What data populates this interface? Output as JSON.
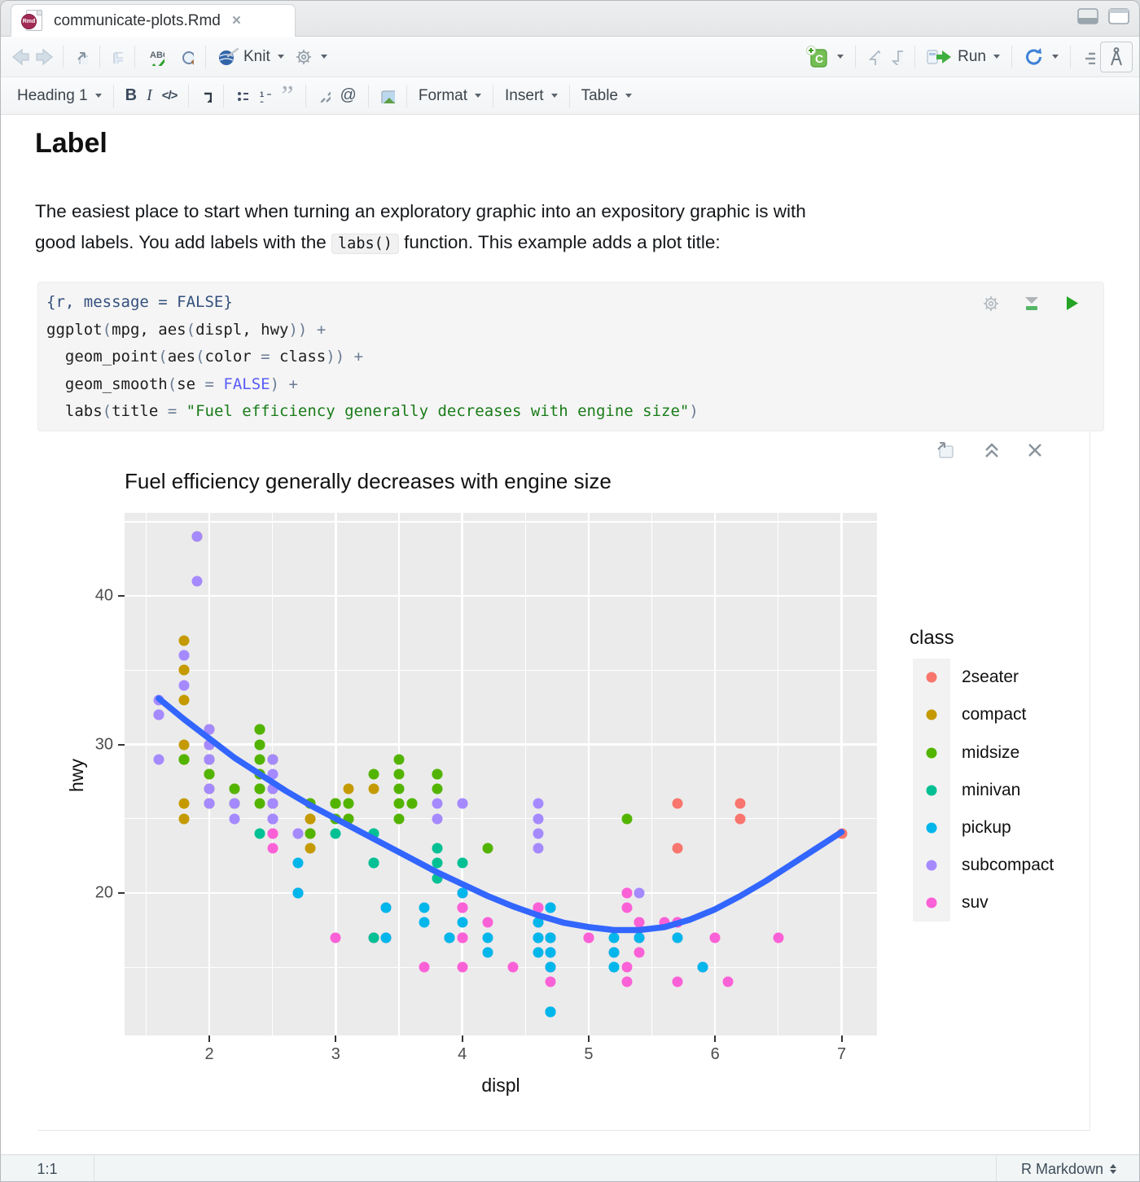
{
  "tab": {
    "title": "communicate-plots.Rmd"
  },
  "icons": {
    "close": "×",
    "quote": "”"
  },
  "toolbar": {
    "knit": "Knit",
    "run": "Run"
  },
  "format_bar": {
    "heading": "Heading 1",
    "bold": "B",
    "italic": "I",
    "code": "</>",
    "at": "@",
    "format": "Format",
    "insert": "Insert",
    "table": "Table"
  },
  "document": {
    "heading": "Label",
    "para_line1": "The easiest place to start when turning an exploratory graphic into an expository graphic is with",
    "para_line2_pre": "good labels. You add labels with the ",
    "para_code": "labs()",
    "para_line2_post": " function. This example adds a plot title:"
  },
  "code_chunk": {
    "colors": {
      "hdr": "#33507D",
      "txt": "#1E1E1E",
      "op": "#6B7B95",
      "const": "#585CF6",
      "str": "#1A7C1A"
    },
    "lines": [
      [
        {
          "t": "{r, message = FALSE}",
          "c": "hdr"
        }
      ],
      [
        {
          "t": "ggplot",
          "c": "txt"
        },
        {
          "t": "(",
          "c": "op"
        },
        {
          "t": "mpg, ",
          "c": "txt"
        },
        {
          "t": "aes",
          "c": "txt"
        },
        {
          "t": "(",
          "c": "op"
        },
        {
          "t": "displ, hwy",
          "c": "txt"
        },
        {
          "t": "))",
          "c": "op"
        },
        {
          "t": " ",
          "c": "txt"
        },
        {
          "t": "+",
          "c": "op"
        }
      ],
      [
        {
          "t": "  geom_point",
          "c": "txt"
        },
        {
          "t": "(",
          "c": "op"
        },
        {
          "t": "aes",
          "c": "txt"
        },
        {
          "t": "(",
          "c": "op"
        },
        {
          "t": "color ",
          "c": "txt"
        },
        {
          "t": "=",
          "c": "op"
        },
        {
          "t": " class",
          "c": "txt"
        },
        {
          "t": "))",
          "c": "op"
        },
        {
          "t": " ",
          "c": "txt"
        },
        {
          "t": "+",
          "c": "op"
        }
      ],
      [
        {
          "t": "  geom_smooth",
          "c": "txt"
        },
        {
          "t": "(",
          "c": "op"
        },
        {
          "t": "se ",
          "c": "txt"
        },
        {
          "t": "=",
          "c": "op"
        },
        {
          "t": " ",
          "c": "txt"
        },
        {
          "t": "FALSE",
          "c": "const"
        },
        {
          "t": ")",
          "c": "op"
        },
        {
          "t": " ",
          "c": "txt"
        },
        {
          "t": "+",
          "c": "op"
        }
      ],
      [
        {
          "t": "  labs",
          "c": "txt"
        },
        {
          "t": "(",
          "c": "op"
        },
        {
          "t": "title ",
          "c": "txt"
        },
        {
          "t": "=",
          "c": "op"
        },
        {
          "t": " ",
          "c": "txt"
        },
        {
          "t": "\"Fuel efficiency generally decreases with engine size\"",
          "c": "str"
        },
        {
          "t": ")",
          "c": "op"
        }
      ]
    ]
  },
  "chart_data": {
    "type": "scatter",
    "title": "Fuel efficiency generally decreases with engine size",
    "xlabel": "displ",
    "ylabel": "hwy",
    "xlim": [
      1.33,
      7.28
    ],
    "ylim": [
      10.4,
      45.6
    ],
    "x_ticks": [
      2,
      3,
      4,
      5,
      6,
      7
    ],
    "y_ticks": [
      20,
      30,
      40
    ],
    "x_minor": [
      1.5,
      2.5,
      3.5,
      4.5,
      5.5,
      6.5
    ],
    "y_minor": [
      15,
      25,
      35,
      45
    ],
    "panel_bg": "#ebebeb",
    "grid_color": "#ffffff",
    "legend": {
      "title": "class",
      "entries": [
        {
          "label": "2seater",
          "color": "#F8766D"
        },
        {
          "label": "compact",
          "color": "#C49A00"
        },
        {
          "label": "midsize",
          "color": "#53B400"
        },
        {
          "label": "minivan",
          "color": "#00C094"
        },
        {
          "label": "pickup",
          "color": "#00B6EB"
        },
        {
          "label": "subcompact",
          "color": "#A58AFF"
        },
        {
          "label": "suv",
          "color": "#FB61D7"
        }
      ]
    },
    "points": [
      [
        1.8,
        29,
        "compact"
      ],
      [
        1.8,
        29,
        "compact"
      ],
      [
        2,
        31,
        "compact"
      ],
      [
        2,
        30,
        "compact"
      ],
      [
        2.8,
        26,
        "compact"
      ],
      [
        2.8,
        26,
        "compact"
      ],
      [
        3.1,
        27,
        "compact"
      ],
      [
        1.8,
        26,
        "compact"
      ],
      [
        1.8,
        25,
        "compact"
      ],
      [
        2,
        28,
        "compact"
      ],
      [
        2,
        27,
        "compact"
      ],
      [
        2.8,
        25,
        "compact"
      ],
      [
        2.8,
        25,
        "compact"
      ],
      [
        3.1,
        25,
        "compact"
      ],
      [
        3.1,
        25,
        "compact"
      ],
      [
        2.2,
        26,
        "compact"
      ],
      [
        2.2,
        27,
        "compact"
      ],
      [
        2.4,
        28,
        "compact"
      ],
      [
        2.4,
        31,
        "compact"
      ],
      [
        3,
        26,
        "compact"
      ],
      [
        3,
        26,
        "compact"
      ],
      [
        3.3,
        27,
        "compact"
      ],
      [
        1.8,
        30,
        "compact"
      ],
      [
        1.8,
        33,
        "compact"
      ],
      [
        1.8,
        35,
        "compact"
      ],
      [
        1.8,
        37,
        "compact"
      ],
      [
        1.8,
        35,
        "compact"
      ],
      [
        2,
        29,
        "compact"
      ],
      [
        2,
        26,
        "compact"
      ],
      [
        2,
        29,
        "compact"
      ],
      [
        2,
        28,
        "compact"
      ],
      [
        2.8,
        24,
        "compact"
      ],
      [
        1.9,
        44,
        "compact"
      ],
      [
        2,
        29,
        "compact"
      ],
      [
        2,
        26,
        "compact"
      ],
      [
        2,
        29,
        "compact"
      ],
      [
        2,
        28,
        "compact"
      ],
      [
        2.5,
        29,
        "compact"
      ],
      [
        2.5,
        29,
        "compact"
      ],
      [
        2.8,
        24,
        "compact"
      ],
      [
        2.8,
        23,
        "compact"
      ],
      [
        2.8,
        24,
        "midsize"
      ],
      [
        3.1,
        25,
        "midsize"
      ],
      [
        4.2,
        23,
        "midsize"
      ],
      [
        2.4,
        27,
        "midsize"
      ],
      [
        2.4,
        30,
        "midsize"
      ],
      [
        3.1,
        26,
        "midsize"
      ],
      [
        3.5,
        29,
        "midsize"
      ],
      [
        3.6,
        26,
        "midsize"
      ],
      [
        2.4,
        26,
        "midsize"
      ],
      [
        2.4,
        27,
        "midsize"
      ],
      [
        2.4,
        30,
        "midsize"
      ],
      [
        2.4,
        31,
        "midsize"
      ],
      [
        2.5,
        26,
        "midsize"
      ],
      [
        2.5,
        26,
        "midsize"
      ],
      [
        3.3,
        28,
        "midsize"
      ],
      [
        2.4,
        29,
        "midsize"
      ],
      [
        2.4,
        27,
        "midsize"
      ],
      [
        2.5,
        26,
        "midsize"
      ],
      [
        2.5,
        27,
        "midsize"
      ],
      [
        3.5,
        26,
        "midsize"
      ],
      [
        3.5,
        27,
        "midsize"
      ],
      [
        3,
        26,
        "midsize"
      ],
      [
        3,
        25,
        "midsize"
      ],
      [
        3.5,
        25,
        "midsize"
      ],
      [
        3.1,
        26,
        "midsize"
      ],
      [
        3.8,
        28,
        "midsize"
      ],
      [
        3.8,
        27,
        "midsize"
      ],
      [
        3.8,
        28,
        "midsize"
      ],
      [
        5.3,
        25,
        "midsize"
      ],
      [
        2.2,
        26,
        "midsize"
      ],
      [
        2.2,
        27,
        "midsize"
      ],
      [
        2.4,
        28,
        "midsize"
      ],
      [
        2.4,
        31,
        "midsize"
      ],
      [
        3,
        26,
        "midsize"
      ],
      [
        3,
        26,
        "midsize"
      ],
      [
        3.5,
        28,
        "midsize"
      ],
      [
        1.8,
        29,
        "midsize"
      ],
      [
        1.8,
        29,
        "midsize"
      ],
      [
        2,
        28,
        "midsize"
      ],
      [
        2,
        29,
        "midsize"
      ],
      [
        2.8,
        26,
        "midsize"
      ],
      [
        2.8,
        26,
        "midsize"
      ],
      [
        3.6,
        26,
        "midsize"
      ],
      [
        5.3,
        20,
        "suv"
      ],
      [
        5.3,
        15,
        "suv"
      ],
      [
        5.3,
        20,
        "suv"
      ],
      [
        5.7,
        17,
        "suv"
      ],
      [
        6,
        17,
        "suv"
      ],
      [
        5.3,
        14,
        "suv"
      ],
      [
        5.3,
        19,
        "suv"
      ],
      [
        5.7,
        14,
        "suv"
      ],
      [
        6.5,
        17,
        "suv"
      ],
      [
        3.9,
        17,
        "suv"
      ],
      [
        4.7,
        17,
        "suv"
      ],
      [
        4.7,
        12,
        "suv"
      ],
      [
        4.7,
        17,
        "suv"
      ],
      [
        4.7,
        16,
        "suv"
      ],
      [
        5.2,
        16,
        "suv"
      ],
      [
        5.7,
        18,
        "suv"
      ],
      [
        5.9,
        15,
        "suv"
      ],
      [
        4.6,
        17,
        "suv"
      ],
      [
        5.4,
        17,
        "suv"
      ],
      [
        5.4,
        18,
        "suv"
      ],
      [
        4,
        17,
        "suv"
      ],
      [
        4,
        19,
        "suv"
      ],
      [
        4,
        17,
        "suv"
      ],
      [
        4,
        19,
        "suv"
      ],
      [
        4.6,
        19,
        "suv"
      ],
      [
        5,
        17,
        "suv"
      ],
      [
        3,
        17,
        "suv"
      ],
      [
        3.7,
        15,
        "suv"
      ],
      [
        4,
        17,
        "suv"
      ],
      [
        4.7,
        19,
        "suv"
      ],
      [
        4.7,
        14,
        "suv"
      ],
      [
        4.7,
        15,
        "suv"
      ],
      [
        5.7,
        18,
        "suv"
      ],
      [
        6.1,
        14,
        "suv"
      ],
      [
        4,
        15,
        "suv"
      ],
      [
        4.2,
        18,
        "suv"
      ],
      [
        4.4,
        15,
        "suv"
      ],
      [
        4.6,
        18,
        "suv"
      ],
      [
        5.4,
        17,
        "suv"
      ],
      [
        5.4,
        16,
        "suv"
      ],
      [
        5.4,
        18,
        "suv"
      ],
      [
        4,
        17,
        "suv"
      ],
      [
        4,
        19,
        "suv"
      ],
      [
        4.6,
        19,
        "suv"
      ],
      [
        5,
        17,
        "suv"
      ],
      [
        3.3,
        17,
        "suv"
      ],
      [
        3.3,
        17,
        "suv"
      ],
      [
        4,
        20,
        "suv"
      ],
      [
        5.6,
        18,
        "suv"
      ],
      [
        2.5,
        26,
        "suv"
      ],
      [
        2.5,
        24,
        "suv"
      ],
      [
        2.5,
        27,
        "suv"
      ],
      [
        2.5,
        25,
        "suv"
      ],
      [
        2.5,
        23,
        "suv"
      ],
      [
        2.5,
        24,
        "suv"
      ],
      [
        2.7,
        20,
        "suv"
      ],
      [
        2.7,
        20,
        "suv"
      ],
      [
        3.4,
        19,
        "suv"
      ],
      [
        3.4,
        17,
        "suv"
      ],
      [
        4,
        20,
        "suv"
      ],
      [
        4.7,
        17,
        "suv"
      ],
      [
        4.7,
        15,
        "suv"
      ],
      [
        5.7,
        18,
        "suv"
      ],
      [
        5.7,
        26,
        "2seater"
      ],
      [
        5.7,
        23,
        "2seater"
      ],
      [
        6.2,
        26,
        "2seater"
      ],
      [
        6.2,
        25,
        "2seater"
      ],
      [
        7,
        24,
        "2seater"
      ],
      [
        2.4,
        24,
        "minivan"
      ],
      [
        3,
        24,
        "minivan"
      ],
      [
        3.3,
        22,
        "minivan"
      ],
      [
        3.3,
        22,
        "minivan"
      ],
      [
        3.3,
        24,
        "minivan"
      ],
      [
        3.3,
        24,
        "minivan"
      ],
      [
        3.3,
        17,
        "minivan"
      ],
      [
        3.8,
        22,
        "minivan"
      ],
      [
        3.8,
        21,
        "minivan"
      ],
      [
        3.8,
        23,
        "minivan"
      ],
      [
        4,
        22,
        "minivan"
      ],
      [
        3.7,
        19,
        "pickup"
      ],
      [
        3.7,
        18,
        "pickup"
      ],
      [
        3.9,
        17,
        "pickup"
      ],
      [
        3.9,
        17,
        "pickup"
      ],
      [
        4.7,
        19,
        "pickup"
      ],
      [
        4.7,
        19,
        "pickup"
      ],
      [
        4.7,
        12,
        "pickup"
      ],
      [
        5.2,
        17,
        "pickup"
      ],
      [
        5.2,
        15,
        "pickup"
      ],
      [
        4.7,
        12,
        "pickup"
      ],
      [
        4.7,
        17,
        "pickup"
      ],
      [
        4.7,
        15,
        "pickup"
      ],
      [
        4.7,
        17,
        "pickup"
      ],
      [
        4.7,
        16,
        "pickup"
      ],
      [
        4.7,
        12,
        "pickup"
      ],
      [
        5.2,
        15,
        "pickup"
      ],
      [
        5.2,
        16,
        "pickup"
      ],
      [
        5.7,
        17,
        "pickup"
      ],
      [
        5.9,
        15,
        "pickup"
      ],
      [
        4.2,
        17,
        "pickup"
      ],
      [
        4.2,
        16,
        "pickup"
      ],
      [
        4.6,
        18,
        "pickup"
      ],
      [
        4.6,
        16,
        "pickup"
      ],
      [
        4.6,
        17,
        "pickup"
      ],
      [
        4.6,
        17,
        "pickup"
      ],
      [
        5.4,
        17,
        "pickup"
      ],
      [
        2.7,
        20,
        "pickup"
      ],
      [
        2.7,
        20,
        "pickup"
      ],
      [
        2.7,
        22,
        "pickup"
      ],
      [
        3.4,
        17,
        "pickup"
      ],
      [
        3.4,
        19,
        "pickup"
      ],
      [
        4,
        18,
        "pickup"
      ],
      [
        4,
        20,
        "pickup"
      ],
      [
        3.8,
        26,
        "subcompact"
      ],
      [
        3.8,
        25,
        "subcompact"
      ],
      [
        4,
        26,
        "subcompact"
      ],
      [
        4,
        26,
        "subcompact"
      ],
      [
        4.6,
        25,
        "subcompact"
      ],
      [
        4.6,
        24,
        "subcompact"
      ],
      [
        4.6,
        26,
        "subcompact"
      ],
      [
        4.6,
        23,
        "subcompact"
      ],
      [
        5.4,
        20,
        "subcompact"
      ],
      [
        1.6,
        33,
        "subcompact"
      ],
      [
        1.6,
        32,
        "subcompact"
      ],
      [
        1.6,
        32,
        "subcompact"
      ],
      [
        1.6,
        29,
        "subcompact"
      ],
      [
        1.6,
        32,
        "subcompact"
      ],
      [
        1.8,
        34,
        "subcompact"
      ],
      [
        1.8,
        36,
        "subcompact"
      ],
      [
        1.8,
        36,
        "subcompact"
      ],
      [
        2,
        29,
        "subcompact"
      ],
      [
        2,
        26,
        "subcompact"
      ],
      [
        2,
        27,
        "subcompact"
      ],
      [
        2,
        30,
        "subcompact"
      ],
      [
        2,
        31,
        "subcompact"
      ],
      [
        2.7,
        24,
        "subcompact"
      ],
      [
        2.7,
        24,
        "subcompact"
      ],
      [
        2.7,
        24,
        "subcompact"
      ],
      [
        2.2,
        26,
        "subcompact"
      ],
      [
        2.2,
        25,
        "subcompact"
      ],
      [
        2.5,
        25,
        "subcompact"
      ],
      [
        2.5,
        27,
        "subcompact"
      ],
      [
        2.5,
        25,
        "subcompact"
      ],
      [
        2.5,
        26,
        "subcompact"
      ],
      [
        1.9,
        44,
        "subcompact"
      ],
      [
        1.9,
        41,
        "subcompact"
      ],
      [
        2,
        29,
        "subcompact"
      ],
      [
        2,
        26,
        "subcompact"
      ],
      [
        2.5,
        28,
        "subcompact"
      ],
      [
        2.5,
        29,
        "subcompact"
      ]
    ],
    "smooth": {
      "color": "#3366FF",
      "points": [
        [
          1.6,
          33.1
        ],
        [
          1.8,
          31.7
        ],
        [
          2,
          30.4
        ],
        [
          2.2,
          29.1
        ],
        [
          2.4,
          28
        ],
        [
          2.6,
          26.9
        ],
        [
          2.8,
          25.9
        ],
        [
          3,
          25
        ],
        [
          3.2,
          24.1
        ],
        [
          3.4,
          23.2
        ],
        [
          3.6,
          22.3
        ],
        [
          3.8,
          21.4
        ],
        [
          4,
          20.6
        ],
        [
          4.2,
          19.8
        ],
        [
          4.4,
          19.1
        ],
        [
          4.6,
          18.5
        ],
        [
          4.8,
          18
        ],
        [
          5,
          17.7
        ],
        [
          5.2,
          17.5
        ],
        [
          5.4,
          17.5
        ],
        [
          5.6,
          17.7
        ],
        [
          5.8,
          18.2
        ],
        [
          6,
          18.9
        ],
        [
          6.2,
          19.8
        ],
        [
          6.4,
          20.8
        ],
        [
          6.6,
          21.9
        ],
        [
          6.8,
          23
        ],
        [
          7,
          24.1
        ]
      ]
    }
  },
  "statusbar": {
    "cursor": "1:1",
    "mode": "R Markdown"
  }
}
